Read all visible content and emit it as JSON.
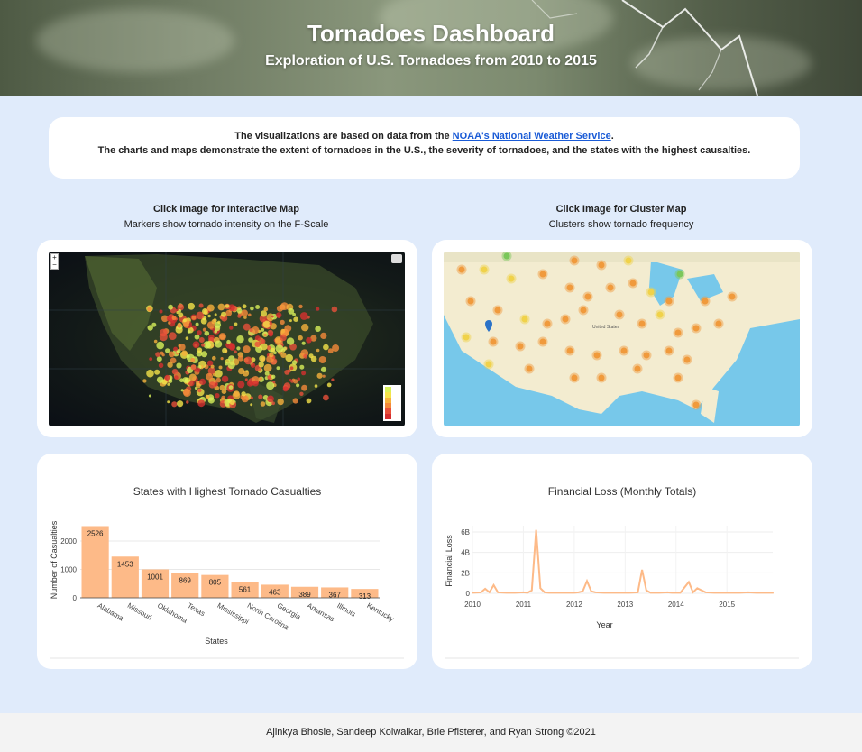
{
  "header": {
    "title": "Tornadoes Dashboard",
    "subtitle": "Exploration of U.S. Tornadoes from 2010 to 2015"
  },
  "info": {
    "line1_prefix": "The visualizations are based on data from the ",
    "link_text": "NOAA's National Weather Service",
    "line1_suffix": ".",
    "line2": "The charts and maps demonstrate the extent of tornadoes in the U.S., the severity of tornadoes, and the states with the highest causalties."
  },
  "interactive_map": {
    "title": "Click Image for Interactive Map",
    "subtitle": "Markers show tornado intensity on the F-Scale",
    "legend_colors": [
      "#d8f05a",
      "#f5e34a",
      "#f7b23c",
      "#f58a3a",
      "#e8503a",
      "#d62f2f"
    ]
  },
  "cluster_map": {
    "title": "Click Image for Cluster Map",
    "subtitle": "Clusters show tornado frequency",
    "city_label": "United States",
    "colors": {
      "orange": "#f09a3c",
      "yellow": "#f0d24a",
      "green": "#7ac75a",
      "land": "#f3ecd0",
      "water": "#77c8ea"
    }
  },
  "footer": {
    "text": "Ajinkya Bhosle, Sandeep Kolwalkar, Brie Pfisterer, and Ryan Strong ©2021"
  },
  "chart_data": [
    {
      "type": "bar",
      "title": "States with Highest Tornado Casualties",
      "xlabel": "States",
      "ylabel": "Number of Casualties",
      "categories": [
        "Alabama",
        "Missouri",
        "Oklahoma",
        "Texas",
        "Mississippi",
        "North Carolina",
        "Georgia",
        "Arkansas",
        "Illinois",
        "Kentucky"
      ],
      "values": [
        2526,
        1453,
        1001,
        869,
        805,
        561,
        463,
        389,
        367,
        313
      ],
      "yticks": [
        0,
        1000,
        2000
      ],
      "ylim": [
        0,
        2700
      ],
      "color": "#fdba88"
    },
    {
      "type": "line",
      "title": "Financial Loss (Monthly Totals)",
      "xlabel": "Year",
      "ylabel": "Financial Loss",
      "xticks": [
        "2010",
        "2011",
        "2012",
        "2013",
        "2014",
        "2015"
      ],
      "yticks": [
        "0",
        "2B",
        "4B",
        "6B"
      ],
      "ylim": [
        0,
        6.5
      ],
      "color": "#fdba88",
      "x": [
        "2010-01",
        "2010-03",
        "2010-04",
        "2010-05",
        "2010-06",
        "2010-07",
        "2010-09",
        "2010-11",
        "2011-01",
        "2011-02",
        "2011-03",
        "2011-04",
        "2011-05",
        "2011-06",
        "2011-07",
        "2011-09",
        "2011-11",
        "2012-01",
        "2012-02",
        "2012-03",
        "2012-04",
        "2012-05",
        "2012-06",
        "2012-08",
        "2012-10",
        "2012-12",
        "2013-02",
        "2013-04",
        "2013-05",
        "2013-06",
        "2013-07",
        "2013-09",
        "2013-11",
        "2013-12",
        "2014-02",
        "2014-04",
        "2014-05",
        "2014-06",
        "2014-08",
        "2014-10",
        "2014-12",
        "2015-02",
        "2015-04",
        "2015-06",
        "2015-08",
        "2015-10",
        "2015-12"
      ],
      "y": [
        0.05,
        0.1,
        0.45,
        0.1,
        0.8,
        0.1,
        0.05,
        0.05,
        0.1,
        0.05,
        0.3,
        6.2,
        0.5,
        0.1,
        0.05,
        0.05,
        0.05,
        0.05,
        0.1,
        0.2,
        1.2,
        0.2,
        0.1,
        0.05,
        0.05,
        0.05,
        0.05,
        0.1,
        2.3,
        0.3,
        0.05,
        0.05,
        0.1,
        0.05,
        0.05,
        1.1,
        0.1,
        0.5,
        0.1,
        0.05,
        0.05,
        0.05,
        0.05,
        0.1,
        0.05,
        0.05,
        0.05
      ]
    }
  ]
}
